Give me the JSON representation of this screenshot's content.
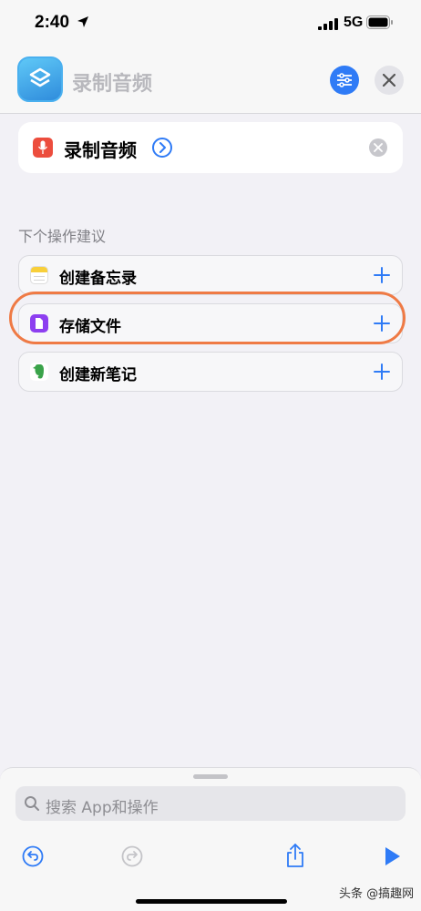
{
  "status": {
    "time": "2:40",
    "network": "5G"
  },
  "header": {
    "title": "录制音频"
  },
  "action": {
    "label": "录制音频"
  },
  "suggestions": {
    "title": "下个操作建议",
    "items": [
      {
        "label": "创建备忘录",
        "icon": "notes-icon"
      },
      {
        "label": "存储文件",
        "icon": "files-icon"
      },
      {
        "label": "创建新笔记",
        "icon": "evernote-icon"
      }
    ]
  },
  "search": {
    "placeholder": "搜索 App和操作"
  },
  "watermark": "头条 @搞趣网",
  "colors": {
    "accent": "#2f7bf6",
    "highlight": "#ef7a45",
    "mic": "#ec4d3d"
  }
}
